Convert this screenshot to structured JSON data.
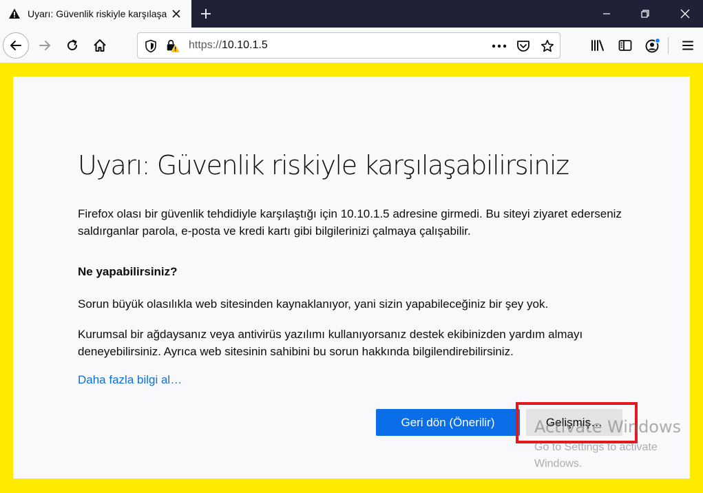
{
  "browser": {
    "tab": {
      "title": "Uyarı: Güvenlik riskiyle karşılaşa"
    },
    "url": {
      "scheme": "https://",
      "host": "10.10.1.5"
    },
    "icons": {
      "tab": "warning-icon",
      "close": "close-icon",
      "new_tab": "plus-icon",
      "back": "back-arrow-icon",
      "forward": "forward-arrow-icon",
      "reload": "reload-icon",
      "home": "home-icon",
      "tracking": "shield-icon",
      "insecure": "insecure-lock-icon",
      "page_actions": "more-icon",
      "pocket": "pocket-icon",
      "bookmark": "star-icon",
      "library": "library-icon",
      "sidebar": "sidebar-icon",
      "account": "account-icon",
      "menu": "hamburger-menu-icon"
    }
  },
  "page": {
    "title": "Uyarı: Güvenlik riskiyle karşılaşabilirsiniz",
    "intro": "Firefox olası bir güvenlik tehdidiyle karşılaştığı için 10.10.1.5 adresine girmedi. Bu siteyi ziyaret ederseniz saldırganlar parola, e-posta ve kredi kartı gibi bilgilerinizi çalmaya çalışabilir.",
    "what_heading": "Ne yapabilirsiniz?",
    "what_p1": "Sorun büyük olasılıkla web sitesinden kaynaklanıyor, yani sizin yapabileceğiniz bir şey yok.",
    "what_p2": "Kurumsal bir ağdaysanız veya antivirüs yazılımı kullanıyorsanız destek ekibinizden yardım almayı deneyebilirsiniz. Ayrıca web sitesinin sahibini bu sorun hakkında bilgilendirebilirsiniz.",
    "learn_more": "Daha fazla bilgi al…",
    "go_back_button": "Geri dön (Önerilir)",
    "advanced_button": "Gelişmiş…"
  },
  "watermark": {
    "title": "Activate Windows",
    "line1": "Go to Settings to activate",
    "line2": "Windows."
  },
  "colors": {
    "frame_accent": "#ffeb00",
    "primary_button": "#0a6ee8",
    "link": "#0a6fd8",
    "highlight": "#e2181c",
    "titlebar": "#1f2237"
  }
}
